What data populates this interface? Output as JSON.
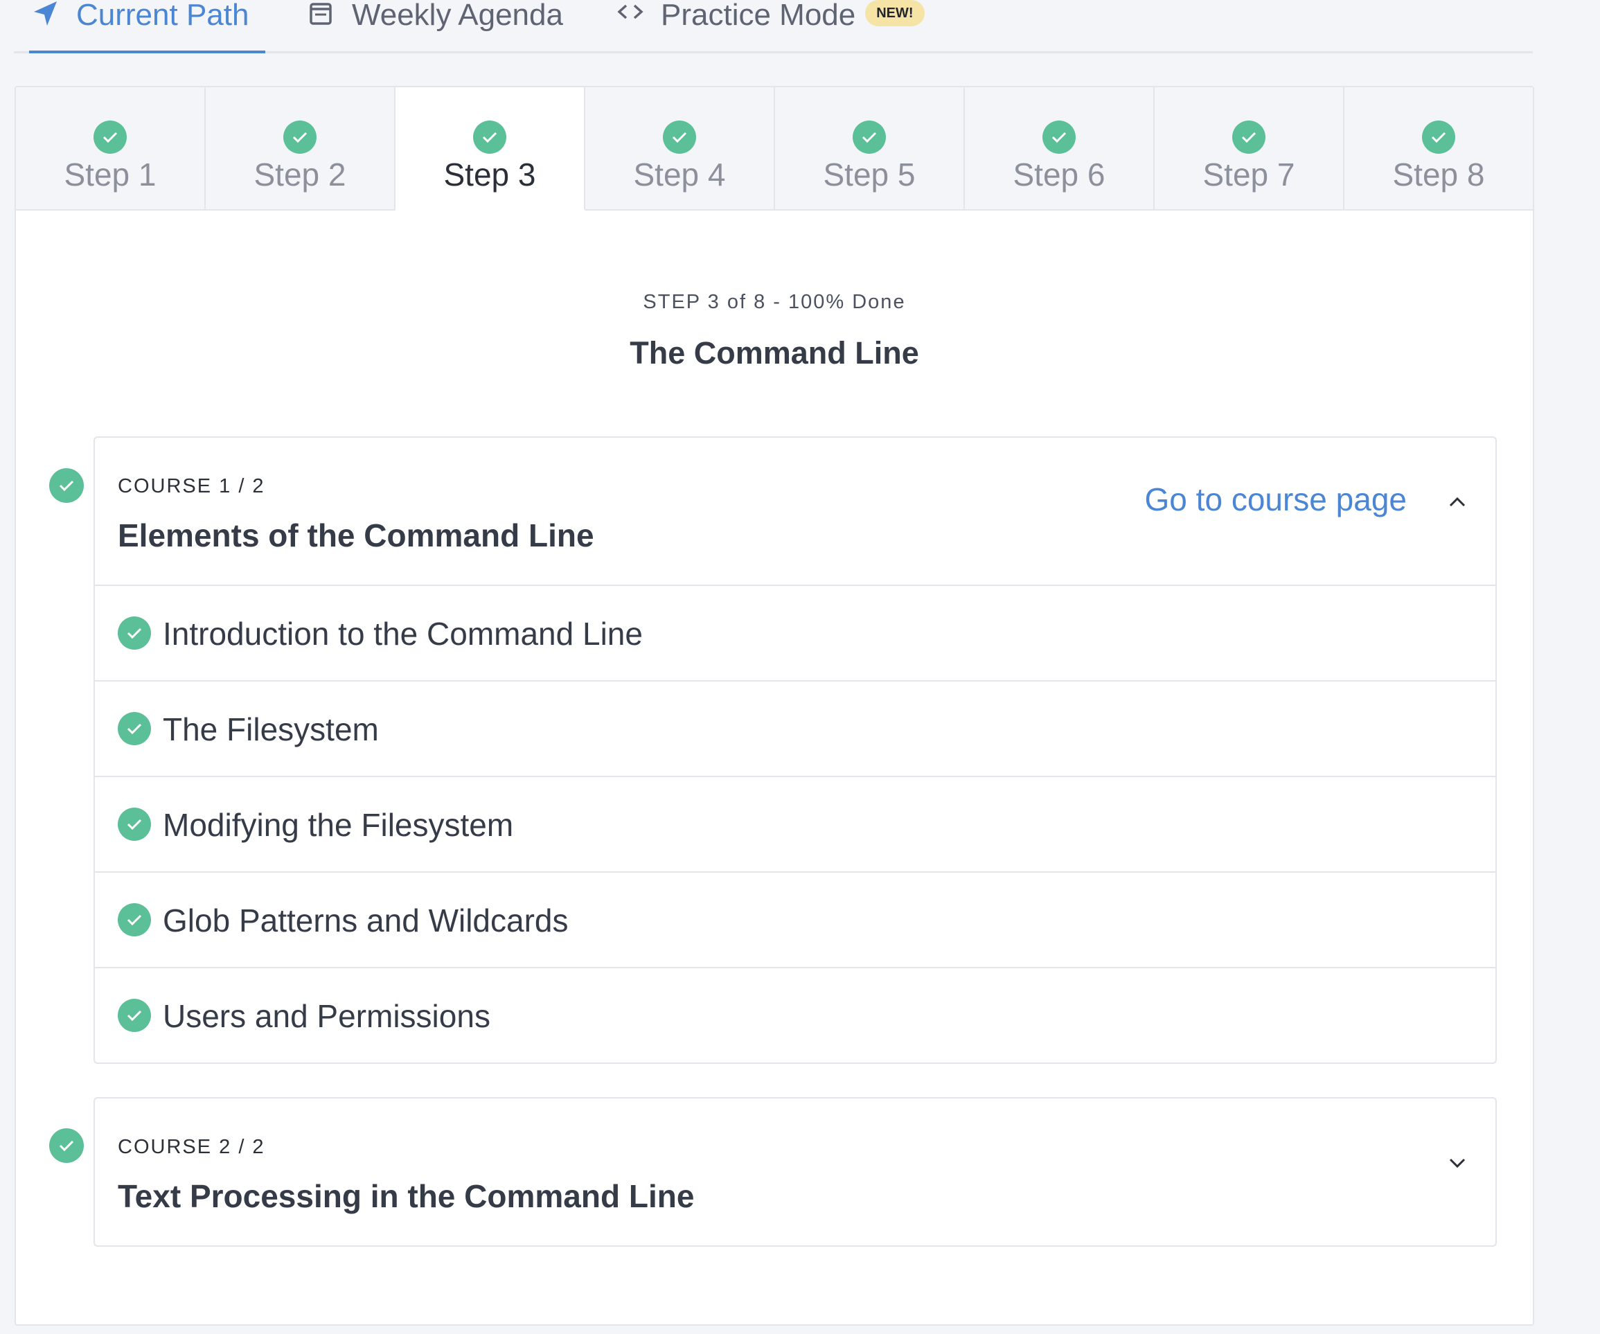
{
  "colors": {
    "accent": "#4a86d4",
    "success": "#5bbf97",
    "badge": "#f6e3a6",
    "text": "#363b48",
    "muted": "#8b909b"
  },
  "top_tabs": [
    {
      "label": "Current Path",
      "icon": "navigation-arrow-icon",
      "active": true
    },
    {
      "label": "Weekly Agenda",
      "icon": "calendar-icon",
      "active": false
    },
    {
      "label": "Practice Mode",
      "icon": "code-brackets-icon",
      "active": false,
      "badge": "NEW!"
    }
  ],
  "steps": [
    {
      "label": "Step 1",
      "completed": true,
      "active": false
    },
    {
      "label": "Step 2",
      "completed": true,
      "active": false
    },
    {
      "label": "Step 3",
      "completed": true,
      "active": true
    },
    {
      "label": "Step 4",
      "completed": true,
      "active": false
    },
    {
      "label": "Step 5",
      "completed": true,
      "active": false
    },
    {
      "label": "Step 6",
      "completed": true,
      "active": false
    },
    {
      "label": "Step 7",
      "completed": true,
      "active": false
    },
    {
      "label": "Step 8",
      "completed": true,
      "active": false
    }
  ],
  "step_header": {
    "progress": "STEP 3 of 8 - 100% Done",
    "title": "The Command Line"
  },
  "courses": [
    {
      "number": "COURSE 1 / 2",
      "title": "Elements of the Command Line",
      "link": "Go to course page",
      "expanded": true,
      "completed": true,
      "lessons": [
        "Introduction to the Command Line",
        "The Filesystem",
        "Modifying the Filesystem",
        "Glob Patterns and Wildcards",
        "Users and Permissions"
      ]
    },
    {
      "number": "COURSE 2 / 2",
      "title": "Text Processing in the Command Line",
      "expanded": false,
      "completed": true
    }
  ]
}
